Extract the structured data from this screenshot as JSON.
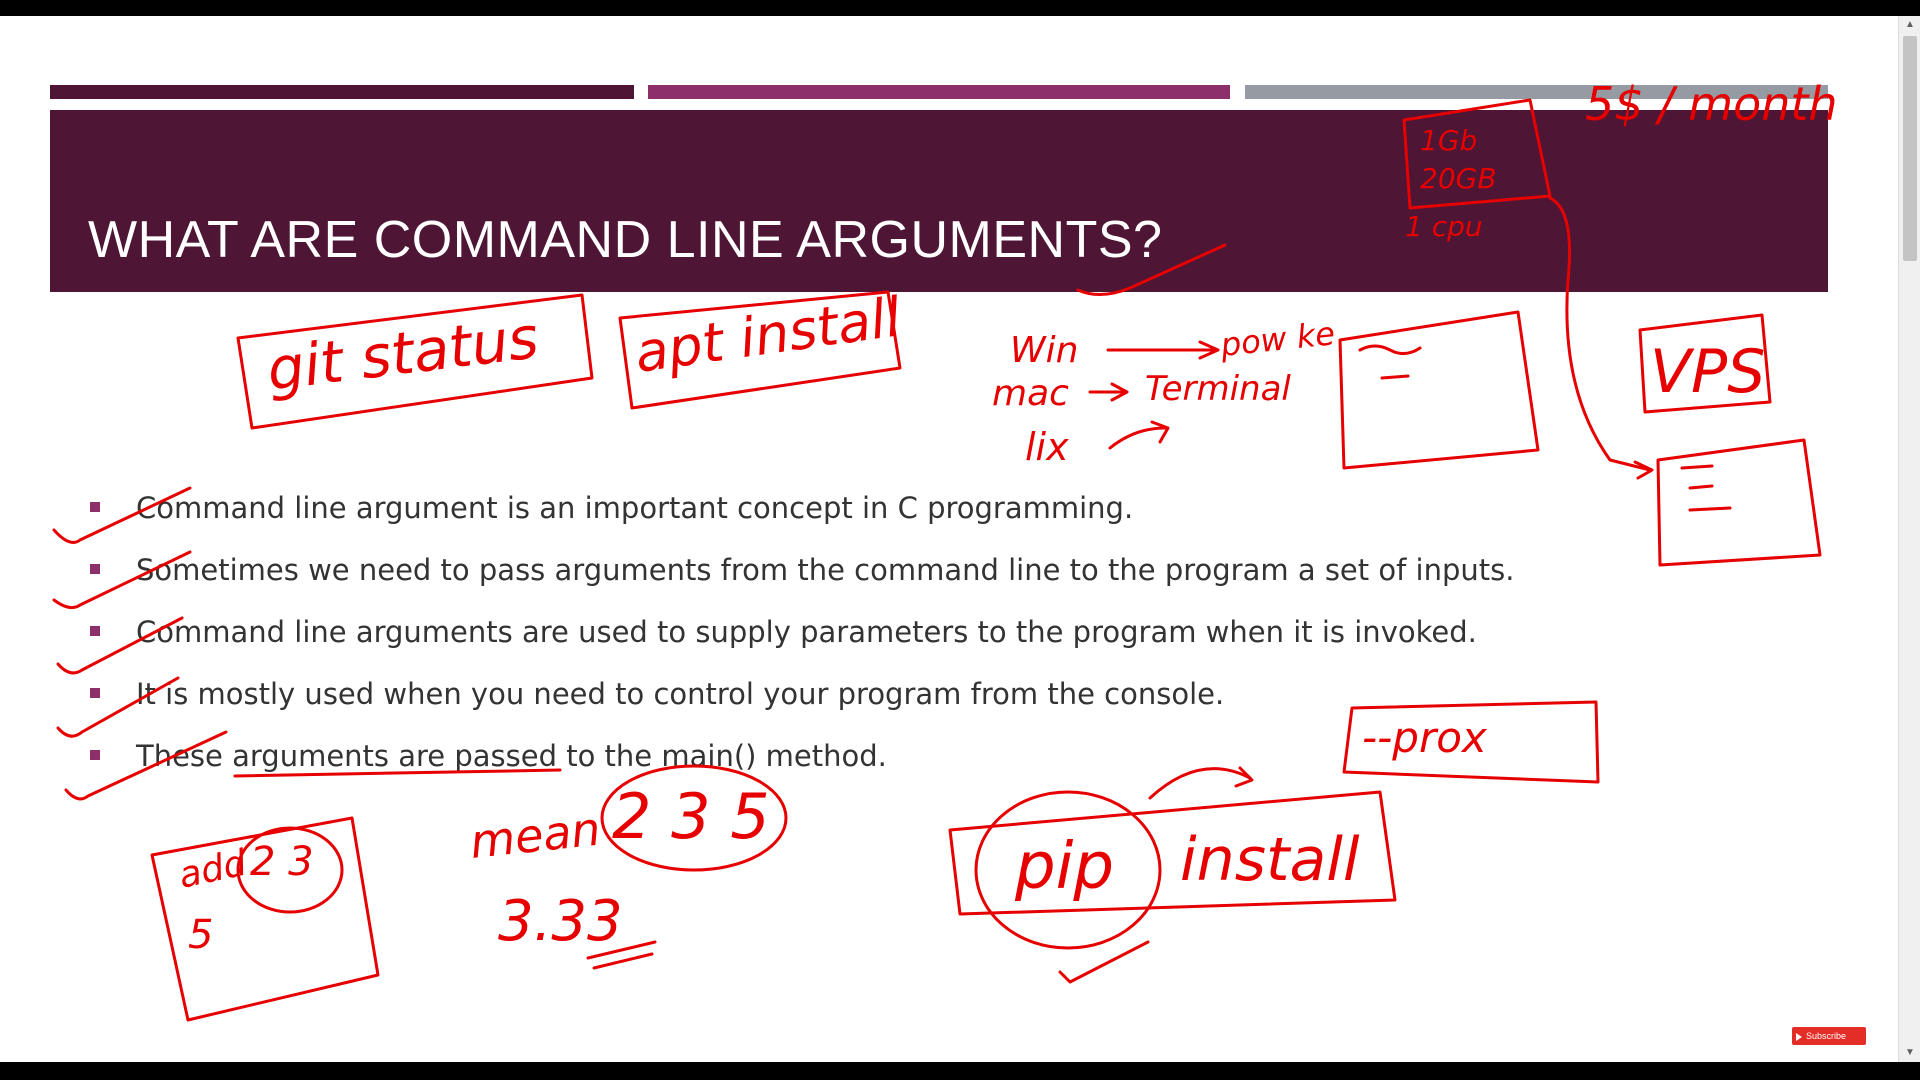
{
  "slide": {
    "title": "WHAT ARE COMMAND LINE ARGUMENTS?",
    "stripe_colors": [
      "#4e1535",
      "#8d2f6a",
      "#959aa3"
    ],
    "banner_color": "#4e1535",
    "bullet_color": "#8d2f6a",
    "bullets": [
      "Command line argument is an important concept in C programming.",
      "Sometimes we need to pass arguments from the command line to the program a set of inputs.",
      "Command line arguments are used to supply parameters to the program when it is invoked.",
      "It is mostly used when you need to control your program from the console.",
      "These arguments are passed to the main() method."
    ]
  },
  "annotations": {
    "ink_color": "#e60000",
    "git_status": "git status",
    "apt_install": "apt install",
    "win": "Win",
    "powershell": "pow ke",
    "mac": "mac",
    "terminal": "Terminal",
    "linux": "lix",
    "vps": "VPS",
    "ram": "1Gb",
    "storage": "20GB",
    "cpu": "1 cpu",
    "price": "5$ / month",
    "proxy": "--prox",
    "pip": "pip",
    "pip_install": "install",
    "add": "add",
    "add_args": "2 3",
    "add_result": "5",
    "mean": "mean",
    "mean_args": "2 3 5",
    "mean_result": "3.33"
  },
  "subscribe_label": "Subscribe"
}
